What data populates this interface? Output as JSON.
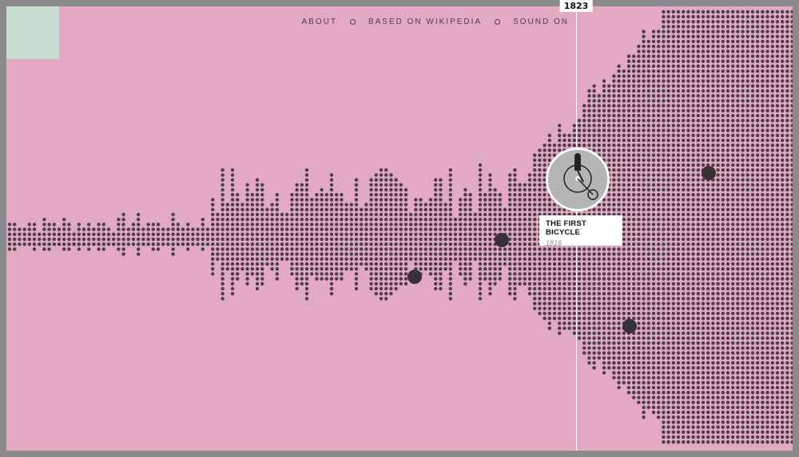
{
  "nav": {
    "about": "ABOUT",
    "based_on": "BASED ON WIKIPEDIA",
    "sound": "SOUND ON"
  },
  "timeline": {
    "current_year": "1823"
  },
  "highlight": {
    "title": "THE FIRST BICYCLE",
    "year": "1816",
    "image_icon": "high-wheel-bicycle-rider-photo"
  },
  "colors": {
    "background": "#e3a9c3",
    "dot": "#4a3f45",
    "frame": "#8a8a8a",
    "accent_square": "#c8dcd0"
  }
}
